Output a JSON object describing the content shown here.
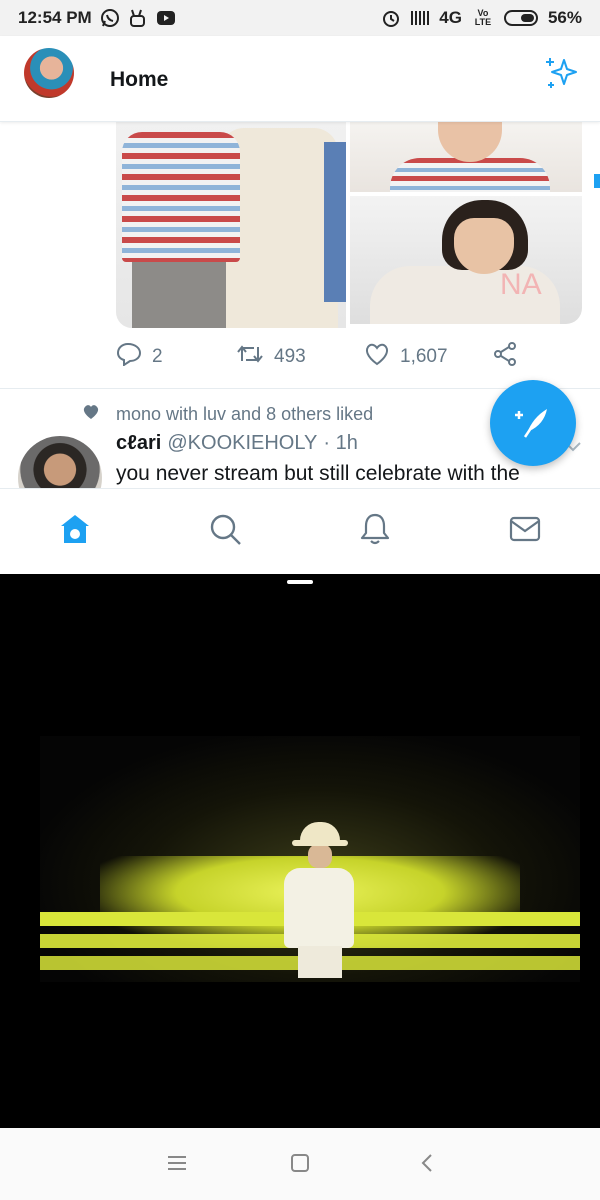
{
  "status_bar": {
    "time": "12:54 PM",
    "network": "4G",
    "volte": "Vo LTE",
    "battery": "56%",
    "icons": [
      "whatsapp-icon",
      "peace-icon",
      "youtube-icon",
      "alarm-icon",
      "signal-icon",
      "battery-icon"
    ]
  },
  "header": {
    "title": "Home",
    "avatar_icon": "profile-avatar",
    "right_icon": "sparkle-icon"
  },
  "tweet_actions": {
    "reply_count": "2",
    "retweet_count": "493",
    "like_count": "1,607"
  },
  "next_tweet": {
    "social_context": "mono with luv and 8 others liked",
    "display_name": "cℓari",
    "handle": "@KOOKIEHOLY",
    "time": "· 1h",
    "text": "you never stream but still celebrate with the"
  },
  "media_overlay_text": "NA",
  "tabs": [
    {
      "name": "home",
      "active": true
    },
    {
      "name": "search",
      "active": false
    },
    {
      "name": "notifications",
      "active": false
    },
    {
      "name": "messages",
      "active": false
    }
  ],
  "colors": {
    "accent": "#1da1f2",
    "secondary_text": "#657786",
    "primary_text": "#14171a"
  }
}
